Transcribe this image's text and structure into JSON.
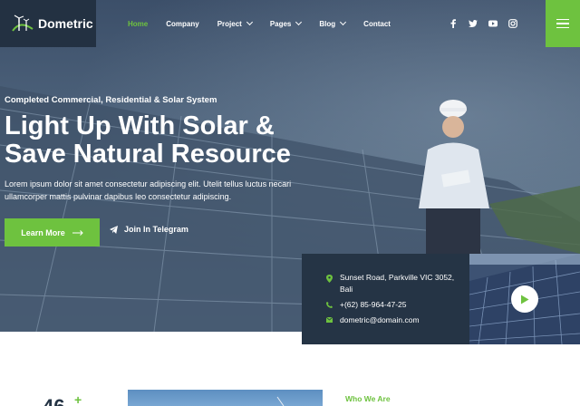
{
  "brand": {
    "name": "Dometric"
  },
  "nav": {
    "items": [
      {
        "label": "Home",
        "active": true,
        "has_dropdown": false
      },
      {
        "label": "Company",
        "active": false,
        "has_dropdown": false
      },
      {
        "label": "Project",
        "active": false,
        "has_dropdown": true
      },
      {
        "label": "Pages",
        "active": false,
        "has_dropdown": true
      },
      {
        "label": "Blog",
        "active": false,
        "has_dropdown": true
      },
      {
        "label": "Contact",
        "active": false,
        "has_dropdown": false
      }
    ],
    "social_icons": [
      "facebook-icon",
      "twitter-icon",
      "youtube-icon",
      "instagram-icon"
    ],
    "menu_icon": "hamburger-menu-icon"
  },
  "hero": {
    "subtitle": "Completed Commercial, Residential & Solar System",
    "title_line1": "Light Up With Solar &",
    "title_line2": "Save Natural Resource",
    "description_line1": "Lorem ipsum dolor sit amet consectetur adipiscing elit. Utelit tellus luctus necari",
    "description_line2": "ullamcorper mattis pulvinar dapibus leo consectetur adipiscing.",
    "primary_button": "Learn More",
    "secondary_button": "Join In Telegram"
  },
  "contact": {
    "address_line1": "Sunset Road, Parkville VIC 3052,",
    "address_line2": "Bali",
    "phone": "+(62) 85-964-47-25",
    "email": "dometric@domain.com"
  },
  "about": {
    "stat_number": "46",
    "stat_suffix": "+",
    "section_label": "Who We Are"
  },
  "colors": {
    "accent": "#6ec23f",
    "dark": "#233142",
    "card": "#253445"
  }
}
